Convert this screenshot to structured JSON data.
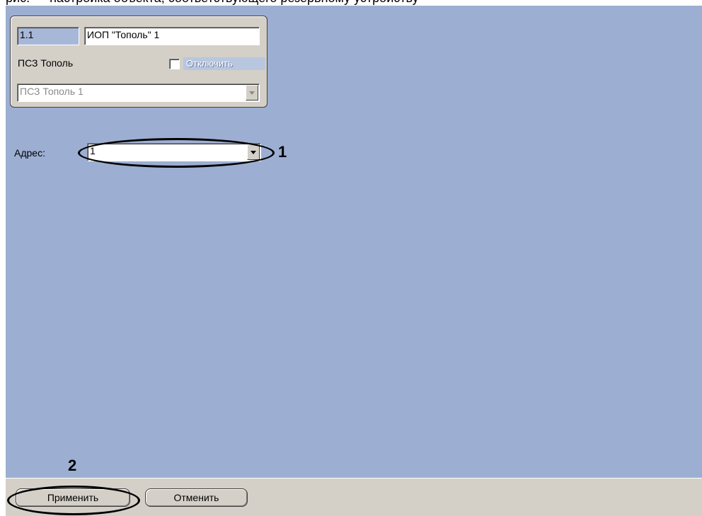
{
  "top_caption": "рис. — настройка объекта, соответствующего резервному устройству",
  "group": {
    "id_value": "1.1",
    "name_value": "ИОП \"Тополь\" 1",
    "parent_label": "ПСЗ Тополь",
    "disable_label": "Отключить",
    "parent_select_value": "ПСЗ Тополь 1"
  },
  "address": {
    "label": "Адрес:",
    "value": "1"
  },
  "callouts": {
    "one": "1",
    "two": "2"
  },
  "buttons": {
    "apply": "Применить",
    "cancel": "Отменить"
  },
  "colors": {
    "panel": "#9caed2",
    "window": "#d4d0c8"
  }
}
